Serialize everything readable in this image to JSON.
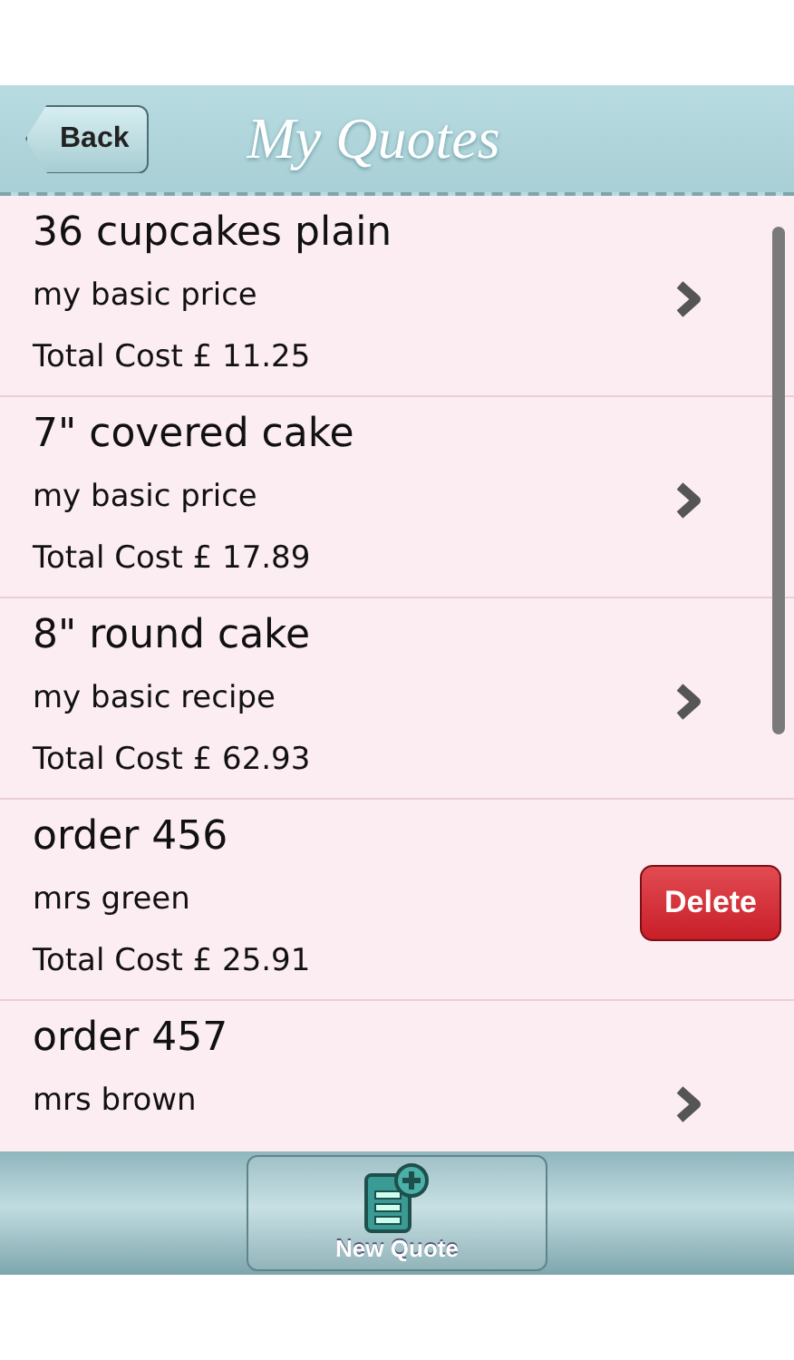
{
  "nav_bar": {
    "back_button": "Back",
    "title": "My Quotes"
  },
  "quotes": [
    {
      "title": "36 cupcakes plain",
      "subtitle": "my basic price",
      "total": "Total Cost £ 11.25",
      "kind": "chevron"
    },
    {
      "title": "7\" covered cake",
      "subtitle": "my basic price",
      "total": "Total Cost £ 17.89",
      "kind": "chevron"
    },
    {
      "title": "8\" round cake",
      "subtitle": "my basic recipe",
      "total": "Total Cost £ 62.93",
      "kind": "chevron"
    },
    {
      "title": "order 456",
      "subtitle": "mrs green",
      "total": "Total Cost £ 25.91",
      "kind": "delete",
      "action_label": "Delete"
    },
    {
      "title": "order 457",
      "subtitle": "mrs brown",
      "kind": "chevron"
    }
  ],
  "toolbar": {
    "new_button": "New Quote"
  }
}
